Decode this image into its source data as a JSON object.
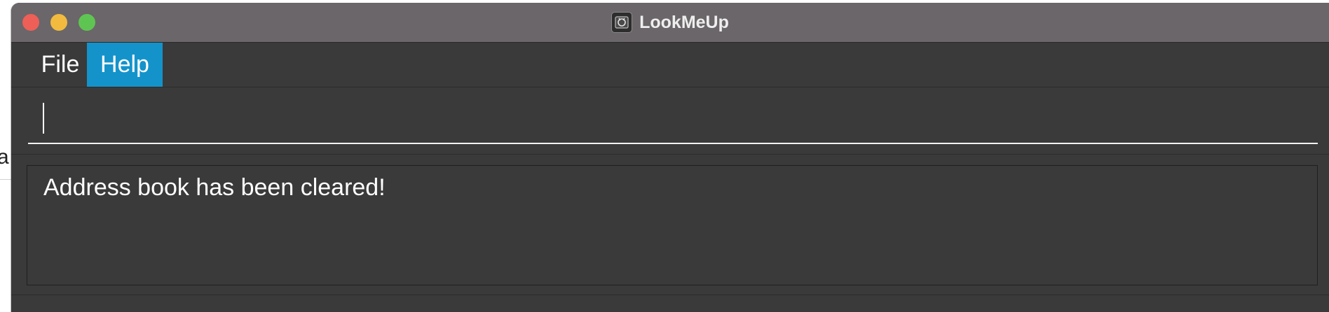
{
  "desktop": {
    "background_fragment": "a"
  },
  "window": {
    "title": "LookMeUp",
    "app_icon": "app-logo-icon",
    "controls": [
      "close",
      "minimize",
      "maximize"
    ]
  },
  "menubar": {
    "items": [
      {
        "label": "File",
        "selected": false
      },
      {
        "label": "Help",
        "selected": true
      }
    ]
  },
  "command_box": {
    "value": "",
    "placeholder": ""
  },
  "result_display": {
    "text": "Address book has been cleared!"
  },
  "colors": {
    "titlebar": "#6b6669",
    "window_bg": "#3a3a3a",
    "menu_selected": "#1493cb",
    "close": "#ee5f57",
    "minimize": "#f2bb3f",
    "maximize": "#5fc552"
  }
}
